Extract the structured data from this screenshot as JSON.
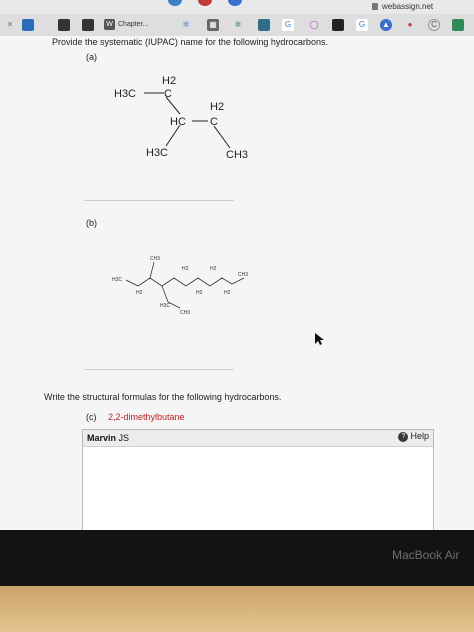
{
  "browser": {
    "url": "webassign.net",
    "tab_label": "Chapter...",
    "tab_badge": "W",
    "extension_letters": [
      "G",
      "G",
      "C"
    ]
  },
  "question": {
    "instruction_1": "Provide the systematic (IUPAC) name for the following hydrocarbons.",
    "part_a_label": "(a)",
    "part_b_label": "(b)",
    "instruction_2": "Write the structural formulas for the following hydrocarbons.",
    "part_c_label": "(c)",
    "part_c_name": "2,2-dimethylbutane"
  },
  "molecule_a": {
    "atom_h3c_top": "H3C",
    "atom_h2_top": "H2",
    "atom_c_top": "C",
    "atom_hc": "HC",
    "atom_h2_right": "H2",
    "atom_c_right": "C",
    "atom_h3c_bottom": "H3C",
    "atom_ch3": "CH3"
  },
  "molecule_b": {
    "left_end": "H3C",
    "top_branch": "CH3",
    "mid_branch": "H3C",
    "mid_branch_end": "CH3",
    "right_end": "CH3",
    "h2_labels": [
      "H2",
      "H2",
      "H2",
      "H2",
      "H2"
    ]
  },
  "marvin": {
    "title_bold": "Marvin",
    "title_rest": "JS",
    "help_label": "Help",
    "help_icon": "?"
  },
  "device": {
    "brand": "MacBook Air"
  }
}
